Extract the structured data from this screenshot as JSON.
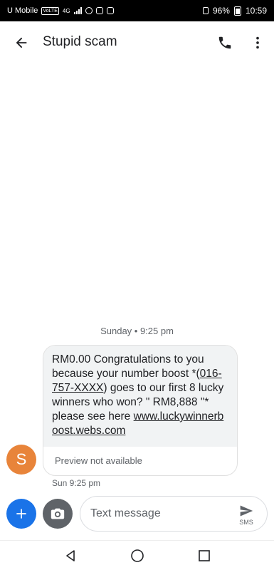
{
  "status_bar": {
    "carrier": "U Mobile",
    "volte": "VoLTE",
    "network": "4G",
    "battery": "96%",
    "time": "10:59"
  },
  "conversation": {
    "title": "Stupid scam"
  },
  "thread": {
    "date_separator": "Sunday • 9:25 pm",
    "avatar_letter": "S",
    "message": {
      "part1": "RM0.00 Congratulations to you because your number boost *(",
      "phone": "016-757-XXXX",
      "part2": ") goes to our first 8 lucky winners who won? \" RM8,888 \"* please see here ",
      "link": "www.luckywinnerboost.webs.com",
      "preview": "Preview not available",
      "time": "Sun 9:25 pm"
    }
  },
  "compose": {
    "placeholder": "Text message",
    "send_label": "SMS"
  },
  "icons": {
    "back": "back-arrow-icon",
    "call": "phone-icon",
    "more": "more-vert-icon",
    "add": "plus-icon",
    "camera": "camera-icon",
    "send": "send-icon",
    "nav_back": "triangle-back-icon",
    "nav_home": "circle-home-icon",
    "nav_recent": "square-recent-icon"
  },
  "colors": {
    "accent": "#1a73e8",
    "avatar": "#e8843a",
    "bubble": "#f1f3f4"
  }
}
